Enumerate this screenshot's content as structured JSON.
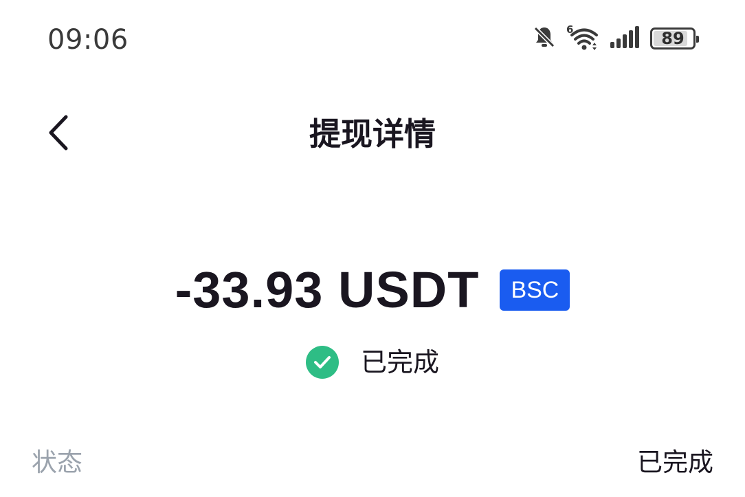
{
  "status_bar": {
    "time": "09:06",
    "wifi_badge": "6",
    "battery_level": "89",
    "battery_fraction": 0.89,
    "icons": [
      "bell-muted-icon",
      "wifi-icon",
      "signal-icon",
      "battery-icon"
    ]
  },
  "nav": {
    "back_icon": "chevron-left-icon",
    "title": "提现详情"
  },
  "transaction": {
    "amount": "-33.93 USDT",
    "network": "BSC",
    "network_color": "#1a5cf0",
    "status_icon": "check-circle-icon",
    "status_color": "#2ebd85",
    "status": "已完成"
  },
  "details": [
    {
      "label": "状态",
      "value": "已完成"
    }
  ]
}
